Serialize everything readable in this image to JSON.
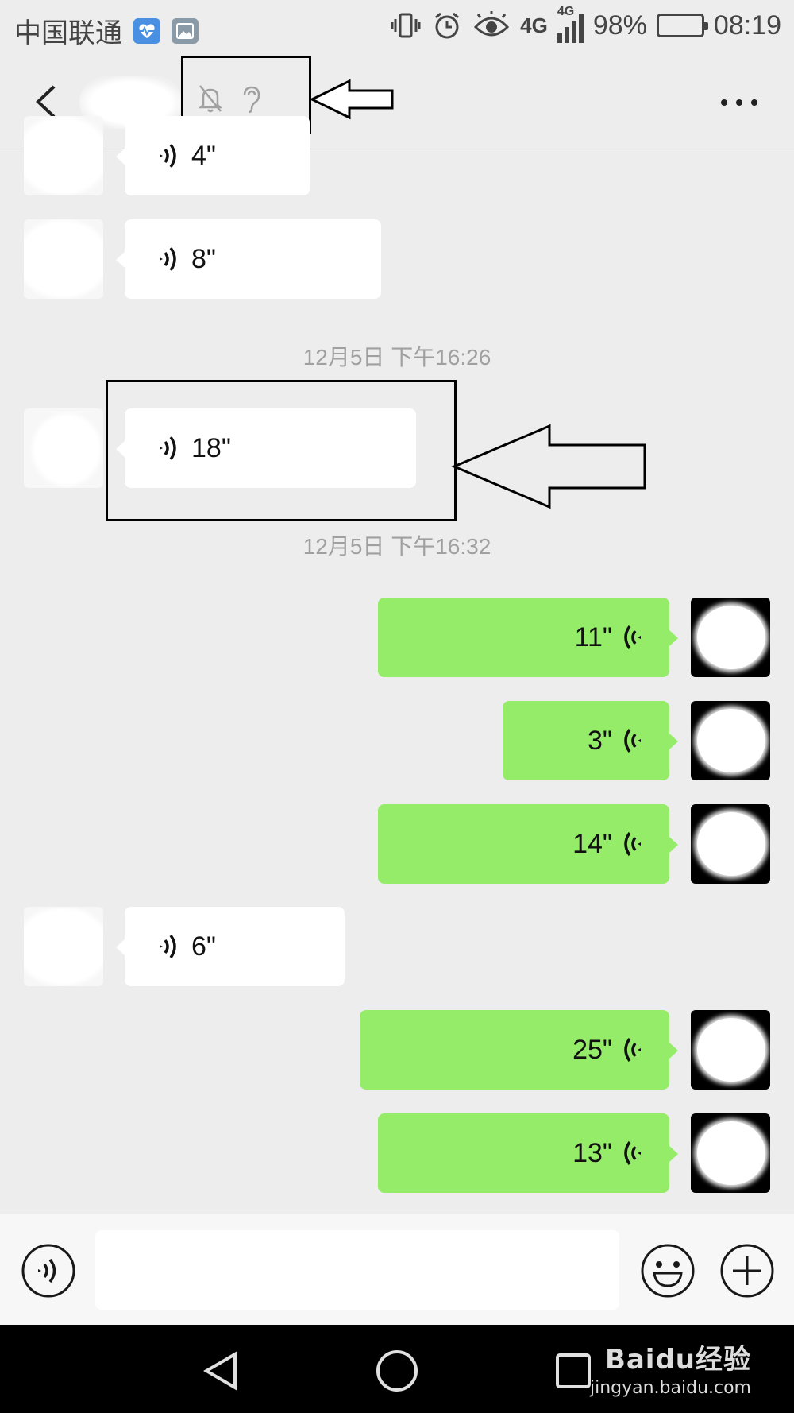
{
  "status_bar": {
    "carrier": "中国联通",
    "network_a": "4G",
    "network_b": "4G",
    "battery": "98%",
    "time": "08:19",
    "icons": [
      "health-app-icon",
      "gallery-app-icon",
      "vibrate-icon",
      "alarm-icon",
      "eye-comfort-icon",
      "signal-icon",
      "battery-icon"
    ]
  },
  "nav": {
    "icons": [
      "back-icon",
      "mute-bell-icon",
      "earpiece-icon",
      "more-icon"
    ]
  },
  "messages": [
    {
      "side": "left",
      "duration": "4\"",
      "kind": "voice"
    },
    {
      "side": "left",
      "duration": "8\"",
      "kind": "voice"
    },
    {
      "timestamp": "12月5日 下午16:26"
    },
    {
      "side": "left",
      "duration": "18\"",
      "kind": "voice"
    },
    {
      "timestamp": "12月5日 下午16:32"
    },
    {
      "side": "right",
      "duration": "11\"",
      "kind": "voice"
    },
    {
      "side": "right",
      "duration": "3\"",
      "kind": "voice"
    },
    {
      "side": "right",
      "duration": "14\"",
      "kind": "voice"
    },
    {
      "side": "left",
      "duration": "6\"",
      "kind": "voice"
    },
    {
      "side": "right",
      "duration": "25\"",
      "kind": "voice"
    },
    {
      "side": "right",
      "duration": "13\"",
      "kind": "voice"
    }
  ],
  "input_bar": {
    "text_value": "",
    "icons": [
      "voice-mode-icon",
      "emoji-icon",
      "plus-icon"
    ]
  },
  "system_nav": {
    "icons": [
      "system-back-icon",
      "home-icon",
      "recents-icon"
    ]
  },
  "watermark": {
    "brand": "Baidu经验",
    "url": "jingyan.baidu.com"
  },
  "colors": {
    "background": "#ededed",
    "bubble_self": "#95ec69",
    "bubble_other": "#ffffff",
    "timestamp": "#a0a0a0"
  }
}
